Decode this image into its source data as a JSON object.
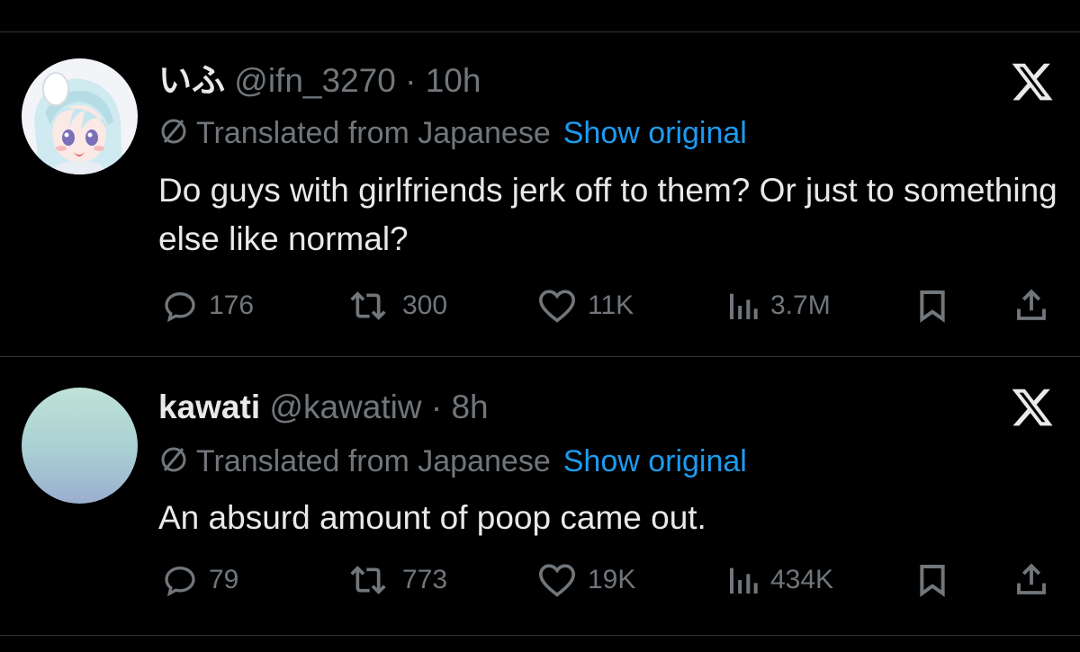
{
  "tweets": [
    {
      "display_name": "いふ",
      "handle": "@ifn_3270",
      "separator": "·",
      "time": "10h",
      "translation_note": "Translated from Japanese",
      "show_original_label": "Show original",
      "text": "Do guys with girlfriends jerk off to them? Or just to something else like normal?",
      "actions": {
        "replies": "176",
        "reposts": "300",
        "likes": "11K",
        "views": "3.7M"
      },
      "avatar_icon": "anime-character-avatar"
    },
    {
      "display_name": "kawati",
      "handle": "@kawatiw",
      "separator": "·",
      "time": "8h",
      "translation_note": "Translated from Japanese",
      "show_original_label": "Show original",
      "text": "An absurd amount of poop came out.",
      "actions": {
        "replies": "79",
        "reposts": "773",
        "likes": "19K",
        "views": "434K"
      },
      "avatar_icon": "gradient-avatar"
    }
  ],
  "colors": {
    "background": "#000000",
    "text_primary": "#e7e9ea",
    "text_secondary": "#71767b",
    "link": "#1d9bf0",
    "divider": "#2f3336"
  }
}
